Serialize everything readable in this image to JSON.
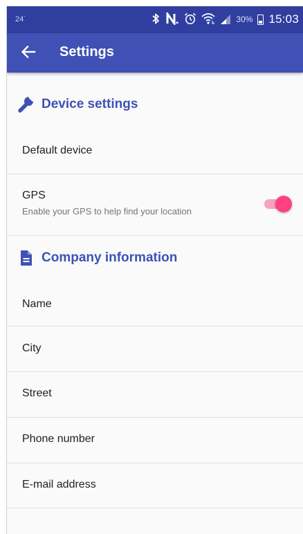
{
  "status_bar": {
    "notification": "24˙",
    "battery_percent": "30%",
    "time": "15:03",
    "icons": [
      "bluetooth-icon",
      "nfc-icon",
      "alarm-icon",
      "wifi-icon",
      "signal-icon",
      "battery-icon"
    ]
  },
  "app_bar": {
    "title": "Settings",
    "back_icon": "arrow-back-icon"
  },
  "sections": {
    "device": {
      "title": "Device settings",
      "icon": "wrench-icon",
      "items": {
        "default_device": {
          "title": "Default device"
        },
        "gps": {
          "title": "GPS",
          "summary": "Enable your GPS to help find your location",
          "enabled": true
        }
      }
    },
    "company": {
      "title": "Company information",
      "icon": "document-icon",
      "items": {
        "name": {
          "title": "Name"
        },
        "city": {
          "title": "City"
        },
        "street": {
          "title": "Street"
        },
        "phone": {
          "title": "Phone number"
        },
        "email": {
          "title": "E-mail address"
        }
      }
    }
  },
  "colors": {
    "status_bar": "#303F9F",
    "primary": "#3F51B5",
    "accent": "#FF4081",
    "background": "#FAFAFA",
    "text_primary": "#212121",
    "text_secondary": "#757575",
    "divider": "#E0E0E0"
  }
}
